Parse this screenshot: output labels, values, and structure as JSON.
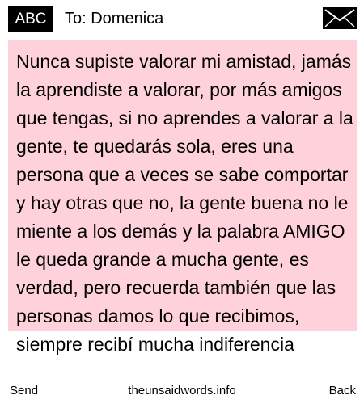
{
  "header": {
    "mode_label": "ABC",
    "recipient": "To: Domenica",
    "icon": "envelope-icon"
  },
  "message": {
    "text": "Nunca supiste valorar mi amistad, jamás la aprendiste a valorar, por más amigos que tengas, si no aprendes a valorar a la gente, te quedarás sola, eres una persona que a veces se sabe comportar y hay otras que no, la gente buena no le miente a los demás y la palabra AMIGO le queda grande a mucha gente, es verdad, pero recuerda también que las personas damos lo que recibimos, siempre recibí mucha indiferencia",
    "highlight_color": "#ffd1da"
  },
  "softkeys": {
    "left": "Send",
    "center": "theunsaidwords.info",
    "right": "Back"
  }
}
